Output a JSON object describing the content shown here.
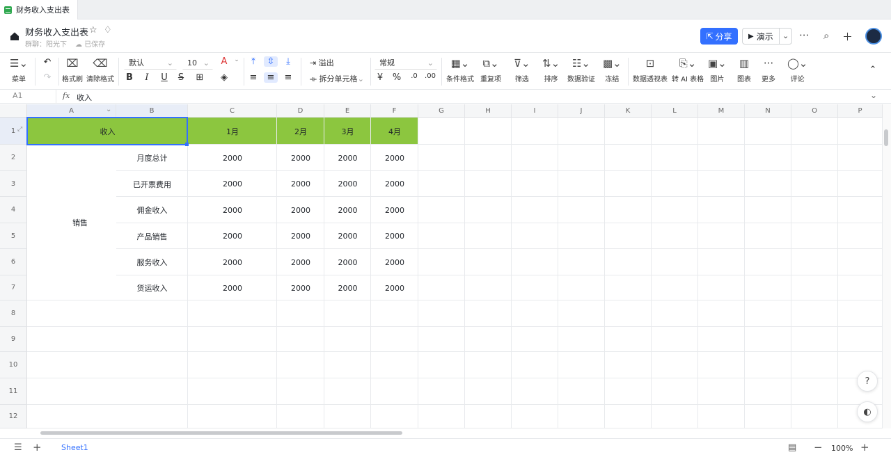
{
  "tab": {
    "title": "财务收入支出表"
  },
  "doc": {
    "title": "财务收入支出表",
    "meta_user": "群聊：阳光下",
    "meta_saved": "已保存"
  },
  "header": {
    "share_label": "分享",
    "present_label": "演示"
  },
  "toolbar": {
    "menu": "菜单",
    "format_painter": "格式刷",
    "clear_format": "清除格式",
    "font": "默认",
    "font_size": "10",
    "overflow": "溢出",
    "split_cells": "拆分单元格",
    "number_format": "常规",
    "conditional": "条件格式",
    "duplicates": "重复项",
    "filter": "筛选",
    "sort": "排序",
    "validation": "数据验证",
    "freeze": "冻结",
    "pivot": "数据透视表",
    "ai_table": "转 AI 表格",
    "image": "图片",
    "chart": "图表",
    "more": "更多",
    "comment": "评论"
  },
  "formula_bar": {
    "cell_ref": "A1",
    "value": "收入"
  },
  "columns": [
    "A",
    "B",
    "C",
    "D",
    "E",
    "F",
    "G",
    "H",
    "I",
    "J",
    "K",
    "L",
    "M",
    "N",
    "O",
    "P"
  ],
  "rows": [
    "1",
    "2",
    "3",
    "4",
    "5",
    "6",
    "7",
    "8",
    "9",
    "10",
    "11",
    "12"
  ],
  "sheet": {
    "a1": "收入",
    "months": [
      "1月",
      "2月",
      "3月",
      "4月"
    ],
    "group_label": "销售",
    "items": [
      {
        "name": "月度总计",
        "values": [
          "2000",
          "2000",
          "2000",
          "2000"
        ]
      },
      {
        "name": "已开票费用",
        "values": [
          "2000",
          "2000",
          "2000",
          "2000"
        ]
      },
      {
        "name": "佣金收入",
        "values": [
          "2000",
          "2000",
          "2000",
          "2000"
        ]
      },
      {
        "name": "产品销售",
        "values": [
          "2000",
          "2000",
          "2000",
          "2000"
        ]
      },
      {
        "name": "服务收入",
        "values": [
          "2000",
          "2000",
          "2000",
          "2000"
        ]
      },
      {
        "name": "货运收入",
        "values": [
          "2000",
          "2000",
          "2000",
          "2000"
        ]
      }
    ],
    "header_fill": "#8cc63f"
  },
  "footer": {
    "sheet_name": "Sheet1",
    "zoom": "100%"
  },
  "colors": {
    "accent": "#3370ff",
    "header_green": "#8cc63f"
  }
}
